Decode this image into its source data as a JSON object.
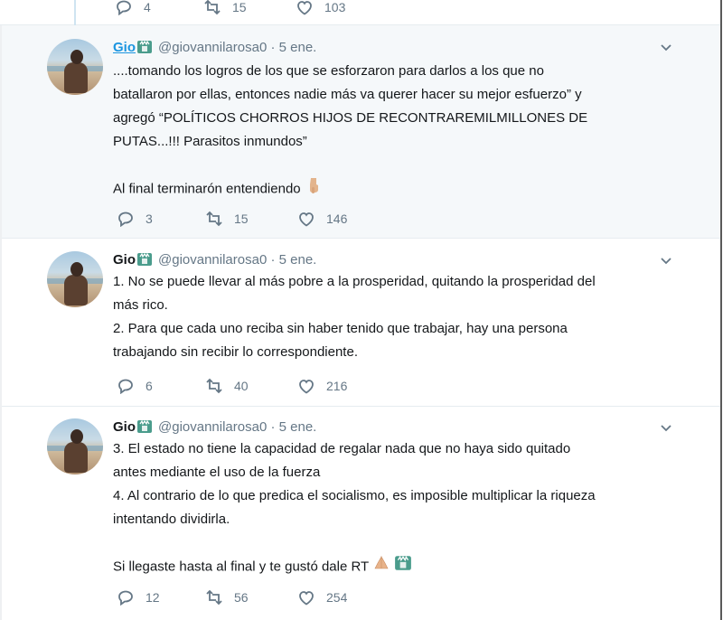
{
  "top_actions": {
    "replies": "4",
    "retweets": "15",
    "likes": "103"
  },
  "tweets": [
    {
      "name": "Gio",
      "handle": "@giovannilarosa0 · 5 ene.",
      "lines": [
        "....tomando los logros de los que se esforzaron para darlos a los que no",
        "batallaron por ellas, entonces nadie más va querer hacer su mejor esfuerzo” y",
        "agregó “POLÍTICOS CHORROS HIJOS DE RECONTRAREMILMILLONES DE",
        "PUTAS...!!! Parasitos inmundos”",
        "",
        "Al final terminarón entendiendo"
      ],
      "replies": "3",
      "retweets": "15",
      "likes": "146"
    },
    {
      "name": "Gio",
      "handle": "@giovannilarosa0 · 5 ene.",
      "lines": [
        "1. No se puede llevar al más pobre a la prosperidad, quitando la prosperidad del",
        "más rico.",
        "2. Para que cada uno reciba sin haber tenido que trabajar, hay una persona",
        "trabajando sin recibir lo correspondiente."
      ],
      "replies": "6",
      "retweets": "40",
      "likes": "216"
    },
    {
      "name": "Gio",
      "handle": "@giovannilarosa0 · 5 ene.",
      "lines": [
        "3. El estado no tiene la capacidad de regalar nada que no haya sido quitado",
        "antes mediante el uso de la fuerza",
        "4. Al contrario de lo que predica el socialismo, es imposible multiplicar la riqueza",
        "intentando dividirla.",
        "",
        "Si llegaste hasta al final y te gustó dale RT"
      ],
      "replies": "12",
      "retweets": "56",
      "likes": "254"
    }
  ],
  "colors": {
    "link": "#1b95e0",
    "muted": "#657786",
    "highlight_bg": "#f5f8fa",
    "badge": "#4a9c8c"
  },
  "icons": [
    "reply-icon",
    "retweet-icon",
    "like-icon",
    "caret-down-icon",
    "statue-of-liberty-emoji",
    "pointing-down-emoji",
    "praying-hands-emoji"
  ]
}
